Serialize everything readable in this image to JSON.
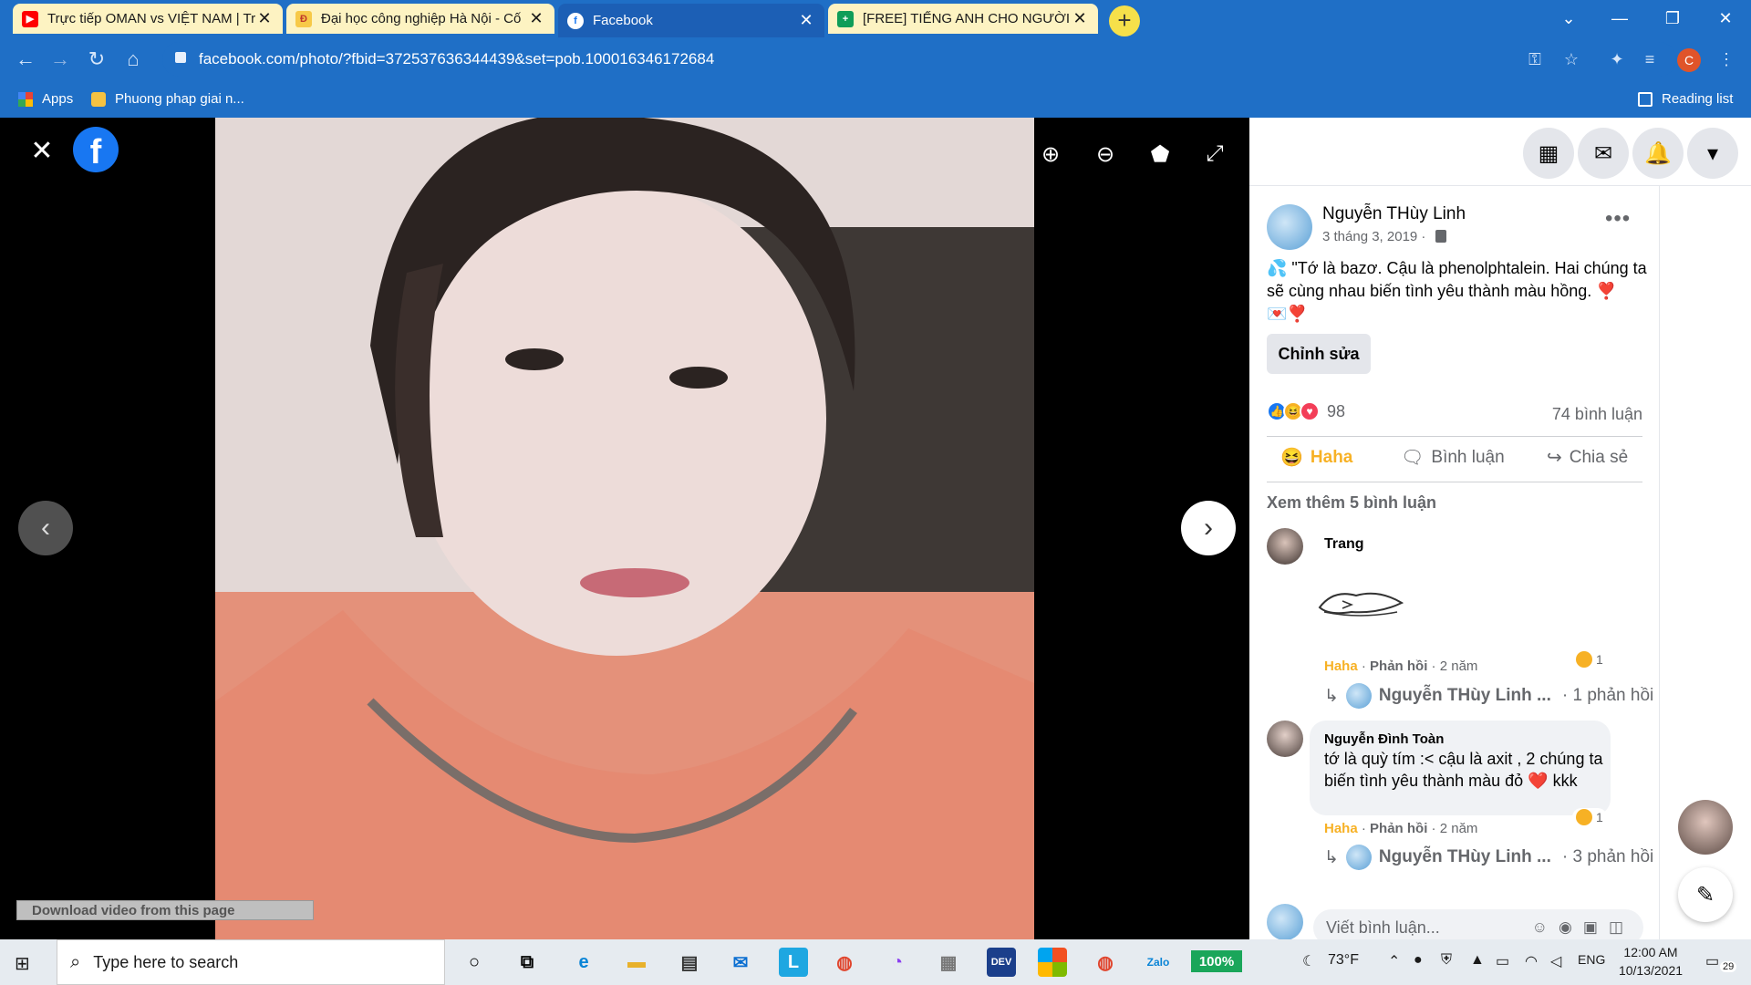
{
  "browser": {
    "tabs": [
      {
        "title": "Trực tiếp OMAN vs VIỆT NAM | Tr",
        "favicon": "youtube-icon"
      },
      {
        "title": "Đại học công nghiệp Hà Nội - Cố",
        "favicon": "haui-icon"
      },
      {
        "title": "Facebook",
        "favicon": "facebook-icon"
      },
      {
        "title": "[FREE] TIẾNG ANH CHO NGƯỜI M",
        "favicon": "sheets-icon"
      }
    ],
    "url": "facebook.com/photo/?fbid=372537636344439&set=pob.100016346172684",
    "profile_initial": "C",
    "bookmarks": [
      {
        "label": "Apps"
      },
      {
        "label": "Phuong phap giai n..."
      }
    ],
    "reading_list": "Reading list"
  },
  "viewer": {
    "download_bar": "Download video from this page"
  },
  "post": {
    "author": "Nguyễn THùy Linh",
    "date": "3 tháng 3, 2019 ·",
    "caption": "💦 \"Tớ là bazơ. Cậu là phenolphtalein. Hai chúng ta sẽ cùng nhau biến tình yêu thành màu hồng. ❣️💌❣️",
    "edit_label": "Chỉnh sửa",
    "reaction_count": "98",
    "comment_count": "74 bình luận",
    "actions": {
      "haha": "Haha",
      "comment": "Bình luận",
      "share": "Chia sẻ"
    },
    "more_comments": "Xem thêm 5 bình luận"
  },
  "comments": [
    {
      "name": "Trang",
      "text": "",
      "reaction_label": "Haha",
      "reply_label": "Phản hồi",
      "age": "2 năm",
      "reaction_count": "1",
      "reply_author": "Nguyễn THùy Linh ...",
      "reply_count": "· 1 phản hồi"
    },
    {
      "name": "Nguyễn Đình Toàn",
      "text": "tớ là quỳ tím :< cậu là axit , 2 chúng ta biến tình yêu thành màu đỏ ❤️ kkk",
      "reaction_label": "Haha",
      "reply_label": "Phản hồi",
      "age": "2 năm",
      "reaction_count": "1",
      "reply_author": "Nguyễn THùy Linh ...",
      "reply_count": "· 3 phản hồi"
    }
  ],
  "comment_input_placeholder": "Viết bình luận...",
  "taskbar": {
    "search_placeholder": "Type here to search",
    "battery": "100%",
    "temperature": "73°F",
    "language": "ENG",
    "time": "12:00 AM",
    "date": "10/13/2021",
    "notification_count": "29"
  },
  "colors": {
    "browser_accent": "#1f6fc6",
    "facebook_blue": "#1877f2",
    "haha_yellow": "#f7b125"
  }
}
